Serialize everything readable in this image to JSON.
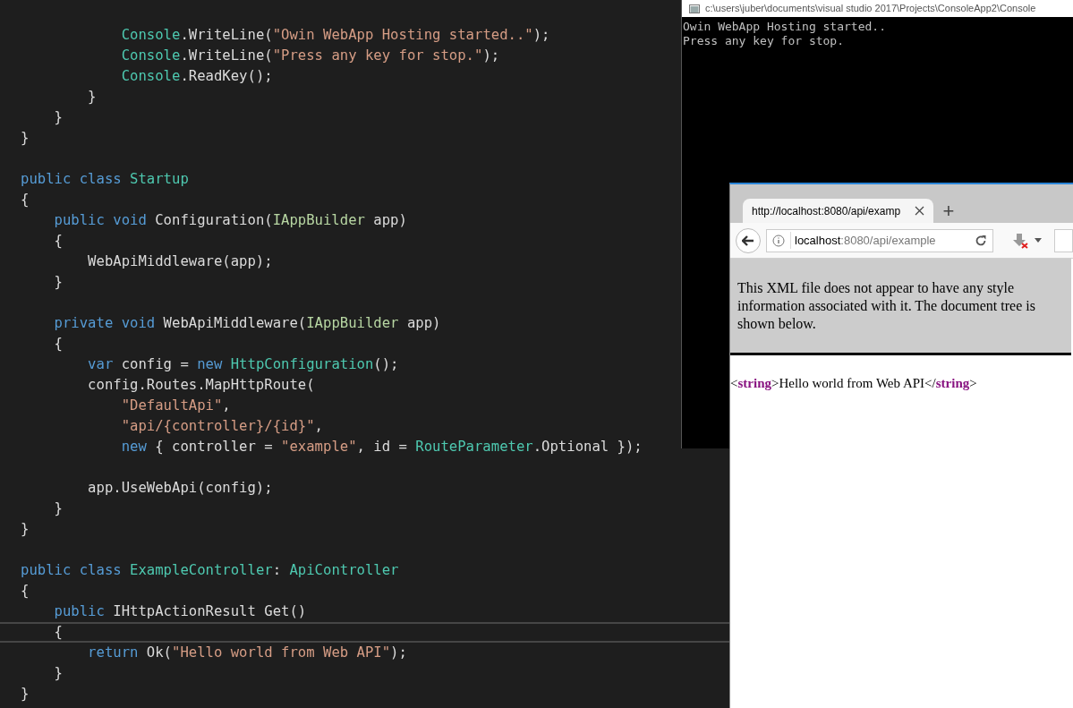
{
  "editor": {
    "lines": [
      {
        "kind": "code",
        "current": false,
        "tokens": [
          {
            "t": "            Console",
            "kind": "type"
          },
          {
            "t": ".WriteLine(",
            "kind": "plain"
          },
          {
            "t": "\"Owin WebApp Hosting started..\"",
            "kind": "string"
          },
          {
            "t": ");",
            "kind": "plain"
          }
        ]
      },
      {
        "kind": "code",
        "current": false,
        "tokens": [
          {
            "t": "            Console",
            "kind": "type"
          },
          {
            "t": ".WriteLine(",
            "kind": "plain"
          },
          {
            "t": "\"Press any key for stop.\"",
            "kind": "string"
          },
          {
            "t": ");",
            "kind": "plain"
          }
        ]
      },
      {
        "kind": "code",
        "current": false,
        "tokens": [
          {
            "t": "            Console",
            "kind": "type"
          },
          {
            "t": ".ReadKey();",
            "kind": "plain"
          }
        ]
      },
      {
        "kind": "code",
        "current": false,
        "tokens": [
          {
            "t": "        }",
            "kind": "plain"
          }
        ]
      },
      {
        "kind": "code",
        "current": false,
        "tokens": [
          {
            "t": "    }",
            "kind": "plain"
          }
        ]
      },
      {
        "kind": "code",
        "current": false,
        "tokens": [
          {
            "t": "}",
            "kind": "plain"
          }
        ]
      },
      {
        "kind": "blank",
        "current": false
      },
      {
        "kind": "code",
        "current": false,
        "tokens": [
          {
            "t": "public class ",
            "kind": "keyword"
          },
          {
            "t": "Startup",
            "kind": "type"
          }
        ]
      },
      {
        "kind": "code",
        "current": false,
        "tokens": [
          {
            "t": "{",
            "kind": "plain"
          }
        ]
      },
      {
        "kind": "code",
        "current": false,
        "tokens": [
          {
            "t": "    public void ",
            "kind": "keyword"
          },
          {
            "t": "Configuration(",
            "kind": "plain"
          },
          {
            "t": "IAppBuilder",
            "kind": "interface"
          },
          {
            "t": " app)",
            "kind": "plain"
          }
        ]
      },
      {
        "kind": "code",
        "current": false,
        "tokens": [
          {
            "t": "    {",
            "kind": "plain"
          }
        ]
      },
      {
        "kind": "code",
        "current": false,
        "tokens": [
          {
            "t": "        WebApiMiddleware(app);",
            "kind": "plain"
          }
        ]
      },
      {
        "kind": "code",
        "current": false,
        "tokens": [
          {
            "t": "    }",
            "kind": "plain"
          }
        ]
      },
      {
        "kind": "blank",
        "current": false
      },
      {
        "kind": "code",
        "current": false,
        "tokens": [
          {
            "t": "    private void ",
            "kind": "keyword"
          },
          {
            "t": "WebApiMiddleware(",
            "kind": "plain"
          },
          {
            "t": "IAppBuilder",
            "kind": "interface"
          },
          {
            "t": " app)",
            "kind": "plain"
          }
        ]
      },
      {
        "kind": "code",
        "current": false,
        "tokens": [
          {
            "t": "    {",
            "kind": "plain"
          }
        ]
      },
      {
        "kind": "code",
        "current": false,
        "tokens": [
          {
            "t": "        var ",
            "kind": "keyword"
          },
          {
            "t": "config = ",
            "kind": "plain"
          },
          {
            "t": "new ",
            "kind": "keyword"
          },
          {
            "t": "HttpConfiguration",
            "kind": "type"
          },
          {
            "t": "();",
            "kind": "plain"
          }
        ]
      },
      {
        "kind": "code",
        "current": false,
        "tokens": [
          {
            "t": "        config.Routes.MapHttpRoute(",
            "kind": "plain"
          }
        ]
      },
      {
        "kind": "code",
        "current": false,
        "tokens": [
          {
            "t": "            \"DefaultApi\"",
            "kind": "string"
          },
          {
            "t": ",",
            "kind": "plain"
          }
        ]
      },
      {
        "kind": "code",
        "current": false,
        "tokens": [
          {
            "t": "            \"api/{controller}/{id}\"",
            "kind": "string"
          },
          {
            "t": ",",
            "kind": "plain"
          }
        ]
      },
      {
        "kind": "code",
        "current": false,
        "tokens": [
          {
            "t": "            new ",
            "kind": "keyword"
          },
          {
            "t": "{ controller = ",
            "kind": "plain"
          },
          {
            "t": "\"example\"",
            "kind": "string"
          },
          {
            "t": ", id = ",
            "kind": "plain"
          },
          {
            "t": "RouteParameter",
            "kind": "type"
          },
          {
            "t": ".Optional });",
            "kind": "plain"
          }
        ]
      },
      {
        "kind": "blank",
        "current": false
      },
      {
        "kind": "code",
        "current": false,
        "tokens": [
          {
            "t": "        app.UseWebApi(config);",
            "kind": "plain"
          }
        ]
      },
      {
        "kind": "code",
        "current": false,
        "tokens": [
          {
            "t": "    }",
            "kind": "plain"
          }
        ]
      },
      {
        "kind": "code",
        "current": false,
        "tokens": [
          {
            "t": "}",
            "kind": "plain"
          }
        ]
      },
      {
        "kind": "blank",
        "current": false
      },
      {
        "kind": "code",
        "current": false,
        "tokens": [
          {
            "t": "public class ",
            "kind": "keyword"
          },
          {
            "t": "ExampleController",
            "kind": "type"
          },
          {
            "t": ": ",
            "kind": "plain"
          },
          {
            "t": "ApiController",
            "kind": "type"
          }
        ]
      },
      {
        "kind": "code",
        "current": false,
        "tokens": [
          {
            "t": "{",
            "kind": "plain"
          }
        ]
      },
      {
        "kind": "code",
        "current": false,
        "tokens": [
          {
            "t": "    public ",
            "kind": "keyword"
          },
          {
            "t": "IHttpActionResult Get()",
            "kind": "plain"
          }
        ]
      },
      {
        "kind": "code",
        "current": true,
        "tokens": [
          {
            "t": "    {",
            "kind": "plain"
          }
        ]
      },
      {
        "kind": "code",
        "current": false,
        "tokens": [
          {
            "t": "        return ",
            "kind": "keyword"
          },
          {
            "t": "Ok(",
            "kind": "plain"
          },
          {
            "t": "\"Hello world from Web API\"",
            "kind": "string"
          },
          {
            "t": ");",
            "kind": "plain"
          }
        ]
      },
      {
        "kind": "code",
        "current": false,
        "tokens": [
          {
            "t": "    }",
            "kind": "plain"
          }
        ]
      },
      {
        "kind": "code",
        "current": false,
        "tokens": [
          {
            "t": "}",
            "kind": "plain"
          }
        ]
      }
    ]
  },
  "console": {
    "title": "c:\\users\\juber\\documents\\visual studio 2017\\Projects\\ConsoleApp2\\Console",
    "output": [
      "Owin WebApp Hosting started..",
      "Press any key for stop."
    ]
  },
  "browser": {
    "tabs": [
      {
        "title": "http://localhost:8080/api/examp",
        "selected": true
      }
    ],
    "new_tab": "+",
    "address": {
      "host": "localhost",
      "path": ":8080/api/example"
    },
    "notice": "This XML file does not appear to have any style information associated with it. The document tree is shown below.",
    "xml": [
      {
        "t": "<",
        "kind": "punct"
      },
      {
        "t": "string",
        "kind": "tag"
      },
      {
        "t": ">Hello world from Web API</",
        "kind": "punct"
      },
      {
        "t": "string",
        "kind": "tag"
      },
      {
        "t": ">",
        "kind": "punct"
      }
    ]
  }
}
